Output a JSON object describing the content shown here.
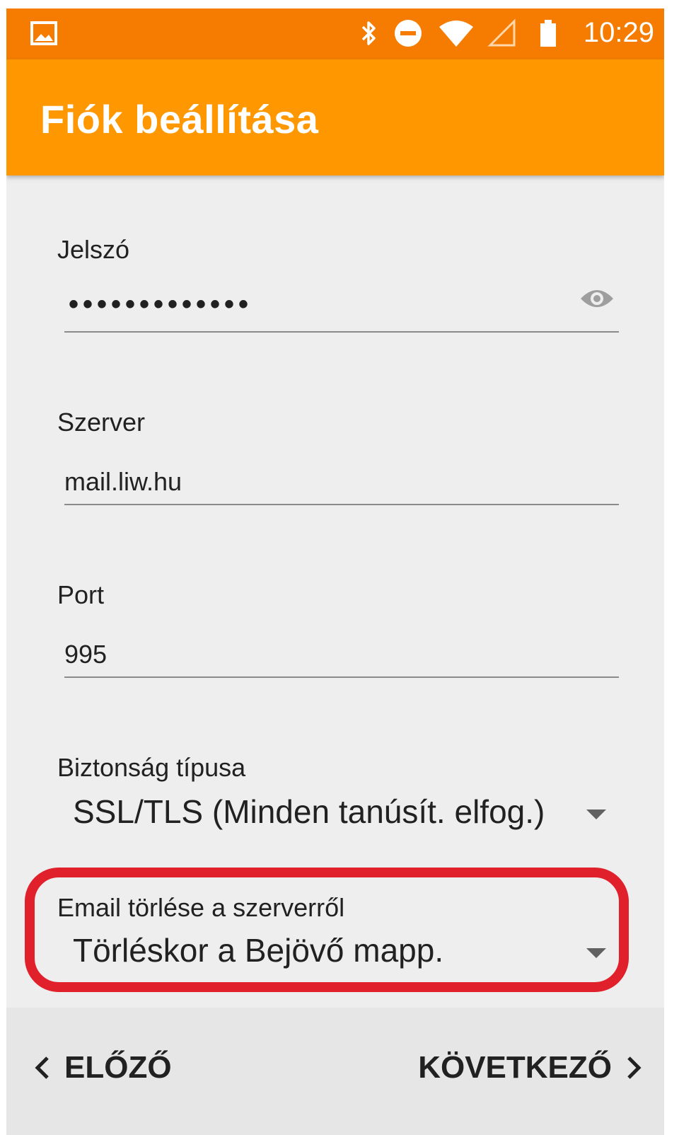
{
  "status_bar": {
    "time": "10:29",
    "icons": [
      "image-icon",
      "bluetooth-icon",
      "do-not-disturb-icon",
      "wifi-icon",
      "cellular-signal-icon",
      "battery-icon"
    ]
  },
  "app_bar": {
    "title": "Fiók beállítása",
    "color": "#ff9800",
    "status_color": "#f57c00"
  },
  "form": {
    "password": {
      "label": "Jelszó",
      "value_masked": "•••••••••••••",
      "toggle_icon": "eye-icon"
    },
    "server": {
      "label": "Szerver",
      "value": "mail.liw.hu"
    },
    "port": {
      "label": "Port",
      "value": "995"
    },
    "security_type": {
      "label": "Biztonság típusa",
      "selected": "SSL/TLS (Minden tanúsít. elfog.)"
    },
    "delete_from_server": {
      "label": "Email törlése a szerverről",
      "selected": "Törléskor a Bejövő mapp.",
      "highlight_color": "#e0202a"
    }
  },
  "navigation": {
    "prev_label": "ELŐZŐ",
    "next_label": "KÖVETKEZŐ"
  }
}
